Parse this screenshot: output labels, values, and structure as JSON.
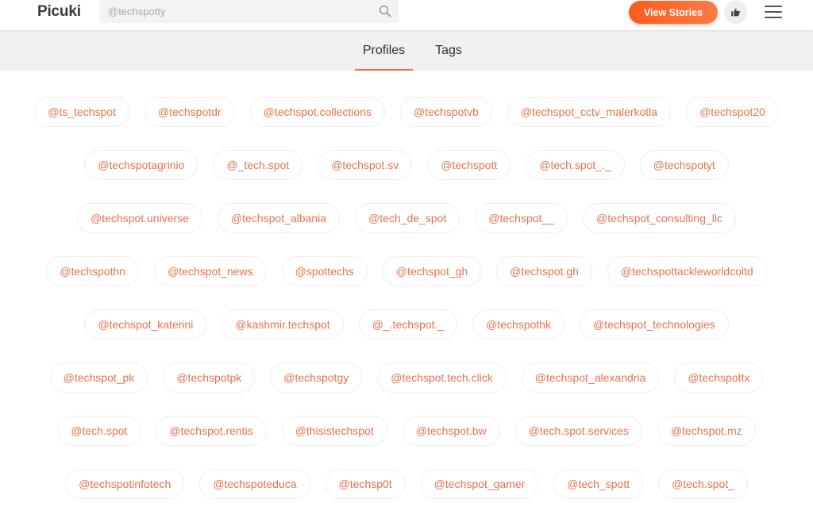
{
  "header": {
    "logo": "Picuki",
    "search": {
      "placeholder": "@techspotty",
      "value": ""
    },
    "view_stories_label": "View Stories",
    "like_icon": "thumbs-up-icon",
    "menu_icon": "hamburger-menu-icon"
  },
  "tabs": [
    {
      "label": "Profiles",
      "active": true
    },
    {
      "label": "Tags",
      "active": false
    }
  ],
  "colors": {
    "accent": "#ff5a1f",
    "chip_text": "#e5734d",
    "tab_underline": "#ef6a3a"
  },
  "profile_rows": [
    [
      "@ts_techspot",
      "@techspotdr",
      "@techspot.collections",
      "@techspotvb",
      "@techspot_cctv_malerkotla",
      "@techspot20"
    ],
    [
      "@techspotagrinio",
      "@_tech.spot",
      "@techspot.sv",
      "@techspott",
      "@tech.spot_._",
      "@techspotyt"
    ],
    [
      "@techspot.universe",
      "@techspot_albania",
      "@tech_de_spot",
      "@techspot__",
      "@techspot_consulting_llc"
    ],
    [
      "@techspothn",
      "@techspot_news",
      "@spottechs",
      "@techspot_gh",
      "@techspot.gh",
      "@techspottackleworldcoltd"
    ],
    [
      "@techspot_katerini",
      "@kashmir.techspot",
      "@_.techspot._",
      "@techspothk",
      "@techspot_technologies"
    ],
    [
      "@techspot_pk",
      "@techspotpk",
      "@techspotgy",
      "@techspot.tech.click",
      "@techspot_alexandria",
      "@techspottx"
    ],
    [
      "@tech.spot",
      "@techspot.rentis",
      "@thisistechspot",
      "@techspot.bw",
      "@tech.spot.services",
      "@techspot.mz"
    ],
    [
      "@techspotinfotech",
      "@techspoteduca",
      "@techsp0t",
      "@techspot_gamer",
      "@tech_spott",
      "@tech.spot_"
    ]
  ]
}
